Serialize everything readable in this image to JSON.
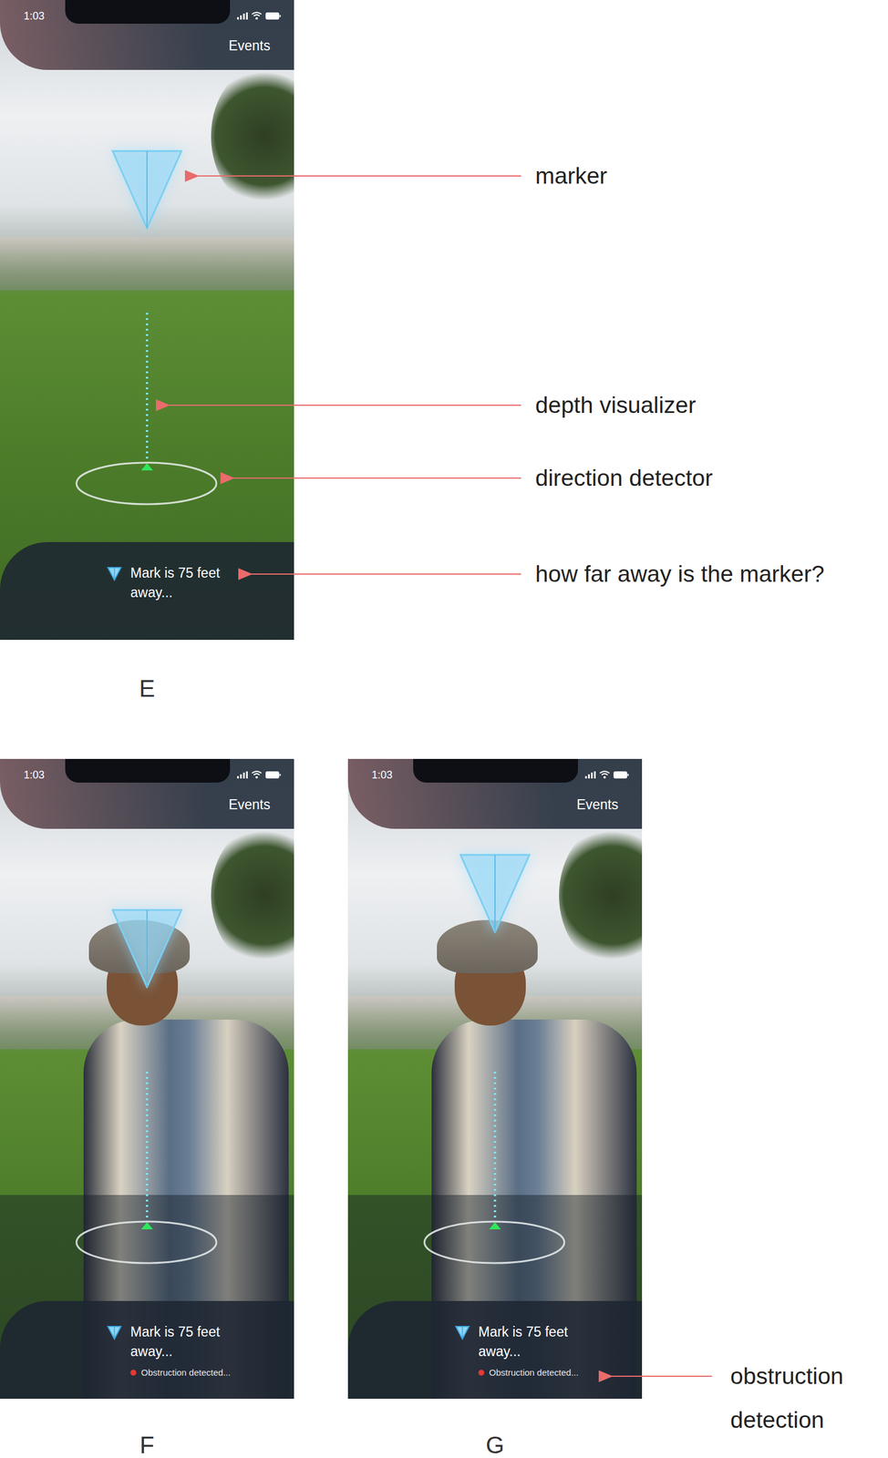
{
  "figure": {
    "screens": [
      {
        "caption": "E",
        "time": "1:03",
        "header": "Events",
        "distance": "Mark is 75 feet away...",
        "person_in_view": false,
        "obstruction": false,
        "marker_lifted": false
      },
      {
        "caption": "F",
        "time": "1:03",
        "header": "Events",
        "distance": "Mark is 75 feet away...",
        "person_in_view": true,
        "obstruction": true,
        "obstruction_text": "Obstruction detected...",
        "marker_lifted": false
      },
      {
        "caption": "G",
        "time": "1:03",
        "header": "Events",
        "distance": "Mark is 75 feet away...",
        "person_in_view": true,
        "obstruction": true,
        "obstruction_text": "Obstruction detected...",
        "marker_lifted": true
      }
    ],
    "annotations": [
      {
        "label": "marker"
      },
      {
        "label": "depth visualizer"
      },
      {
        "label": "direction detector"
      },
      {
        "label": "how far away is the marker?"
      },
      {
        "label": "obstruction detection"
      }
    ]
  }
}
